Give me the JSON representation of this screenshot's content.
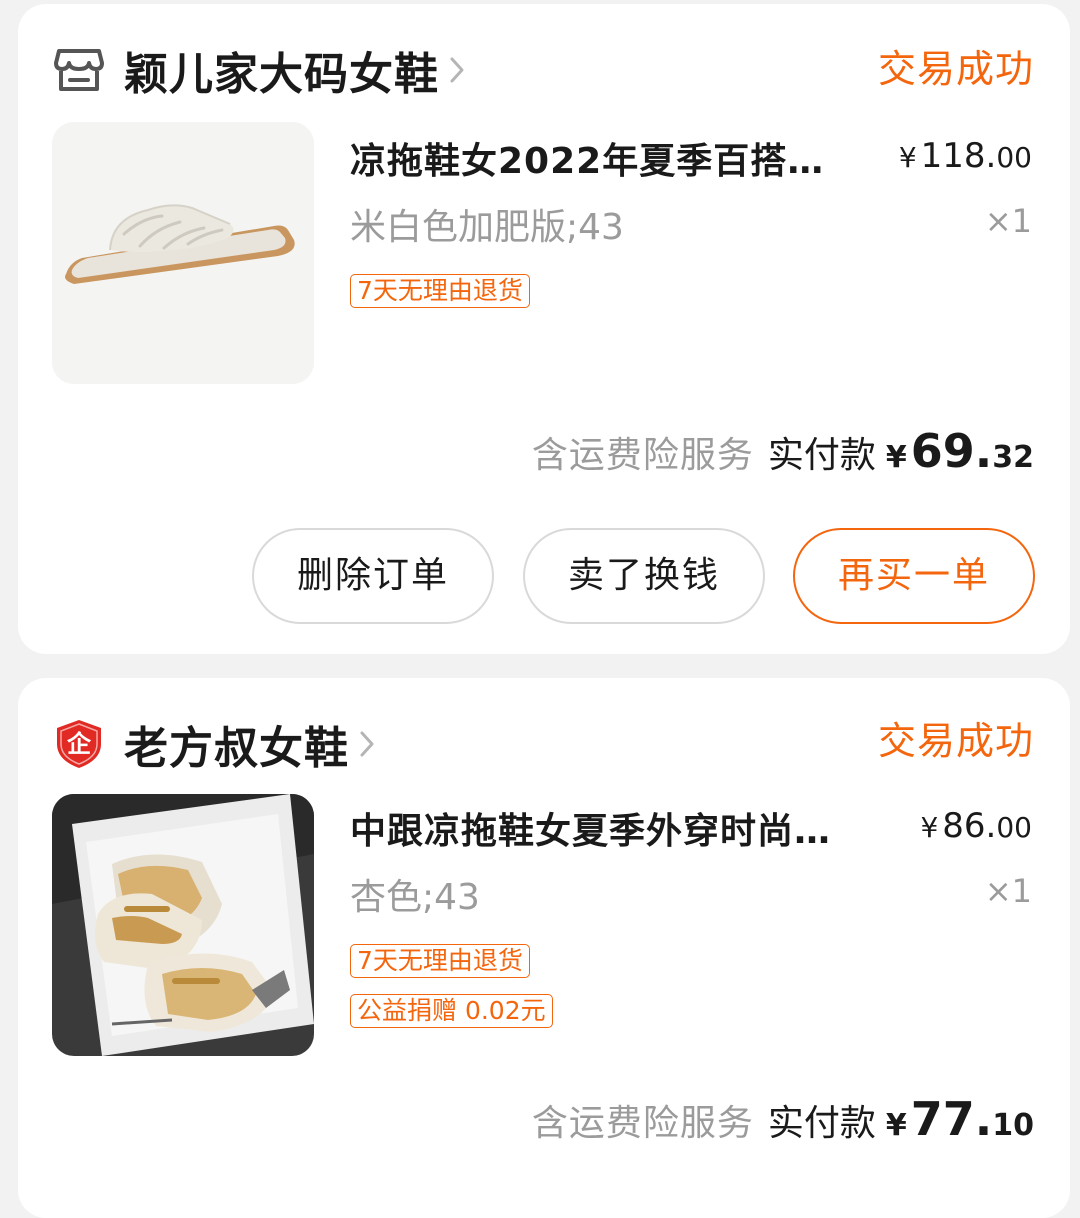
{
  "colors": {
    "accent": "#f4660e",
    "muted": "#9b9b9b",
    "text": "#1a1a1a",
    "background": "#f2f2f2"
  },
  "orders": [
    {
      "shop": {
        "icon": "store-icon",
        "name": "颖儿家大码女鞋"
      },
      "status": "交易成功",
      "item": {
        "image": "white-slide-sandal",
        "title": "凉拖鞋女2022年夏季百搭…",
        "price": {
          "yen": "¥",
          "int": "118.",
          "dec": "00"
        },
        "spec": "米白色加肥版;43",
        "qty": "×1",
        "tags": [
          "7天无理由退货"
        ]
      },
      "total": {
        "insurance": "含运费险服务",
        "paid_label": "实付款",
        "yen": "¥",
        "int": "69.",
        "dec": "32"
      },
      "buttons": {
        "delete": "删除订单",
        "resell": "卖了换钱",
        "rebuy": "再买一单"
      }
    },
    {
      "shop": {
        "icon": "enterprise-shield-icon",
        "badge_text": "企",
        "name": "老方叔女鞋"
      },
      "status": "交易成功",
      "item": {
        "image": "beige-heeled-slide-in-box",
        "title": "中跟凉拖鞋女夏季外穿时尚…",
        "price": {
          "yen": "¥",
          "int": "86.",
          "dec": "00"
        },
        "spec": "杏色;43",
        "qty": "×1",
        "tags": [
          "7天无理由退货",
          "公益捐赠 0.02元"
        ]
      },
      "total": {
        "insurance": "含运费险服务",
        "paid_label": "实付款",
        "yen": "¥",
        "int": "77.",
        "dec": "10"
      }
    }
  ]
}
